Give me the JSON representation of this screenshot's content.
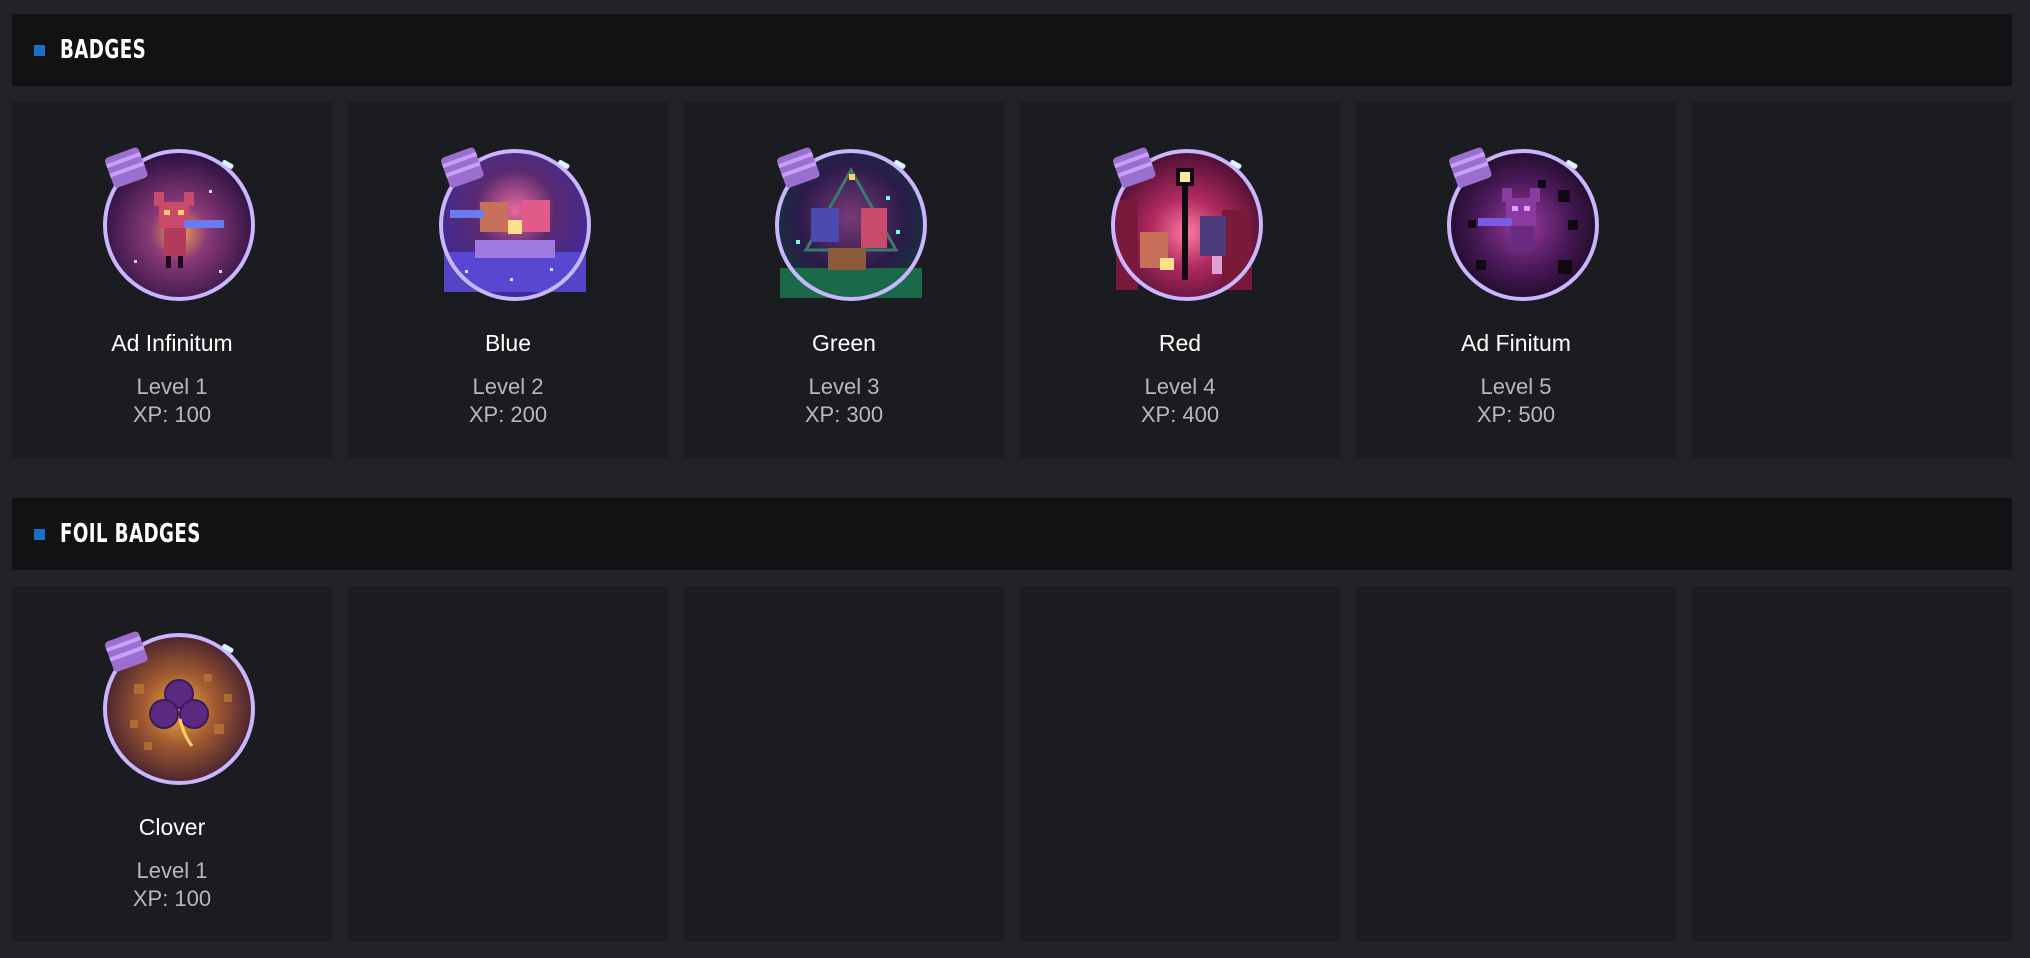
{
  "sections": {
    "badges": {
      "title": "BADGES",
      "items": [
        {
          "name": "Ad Infinitum",
          "level": "Level 1",
          "xp": "XP: 100",
          "icon": "bottle-cat-icon"
        },
        {
          "name": "Blue",
          "level": "Level 2",
          "xp": "XP: 200",
          "icon": "bottle-boat-icon"
        },
        {
          "name": "Green",
          "level": "Level 3",
          "xp": "XP: 300",
          "icon": "bottle-forest-icon"
        },
        {
          "name": "Red",
          "level": "Level 4",
          "xp": "XP: 400",
          "icon": "bottle-city-icon"
        },
        {
          "name": "Ad Finitum",
          "level": "Level 5",
          "xp": "XP: 500",
          "icon": "bottle-void-icon"
        }
      ]
    },
    "foil_badges": {
      "title": "FOIL BADGES",
      "items": [
        {
          "name": "Clover",
          "level": "Level 1",
          "xp": "XP: 100",
          "icon": "bottle-clover-icon"
        }
      ]
    }
  },
  "colors": {
    "background": "#222327",
    "header": "#111214",
    "card": "#1b1c1f",
    "accent": "#1a6fc8",
    "bottle_rim": "#c9b6ff",
    "cap": "#9b6fd0"
  }
}
